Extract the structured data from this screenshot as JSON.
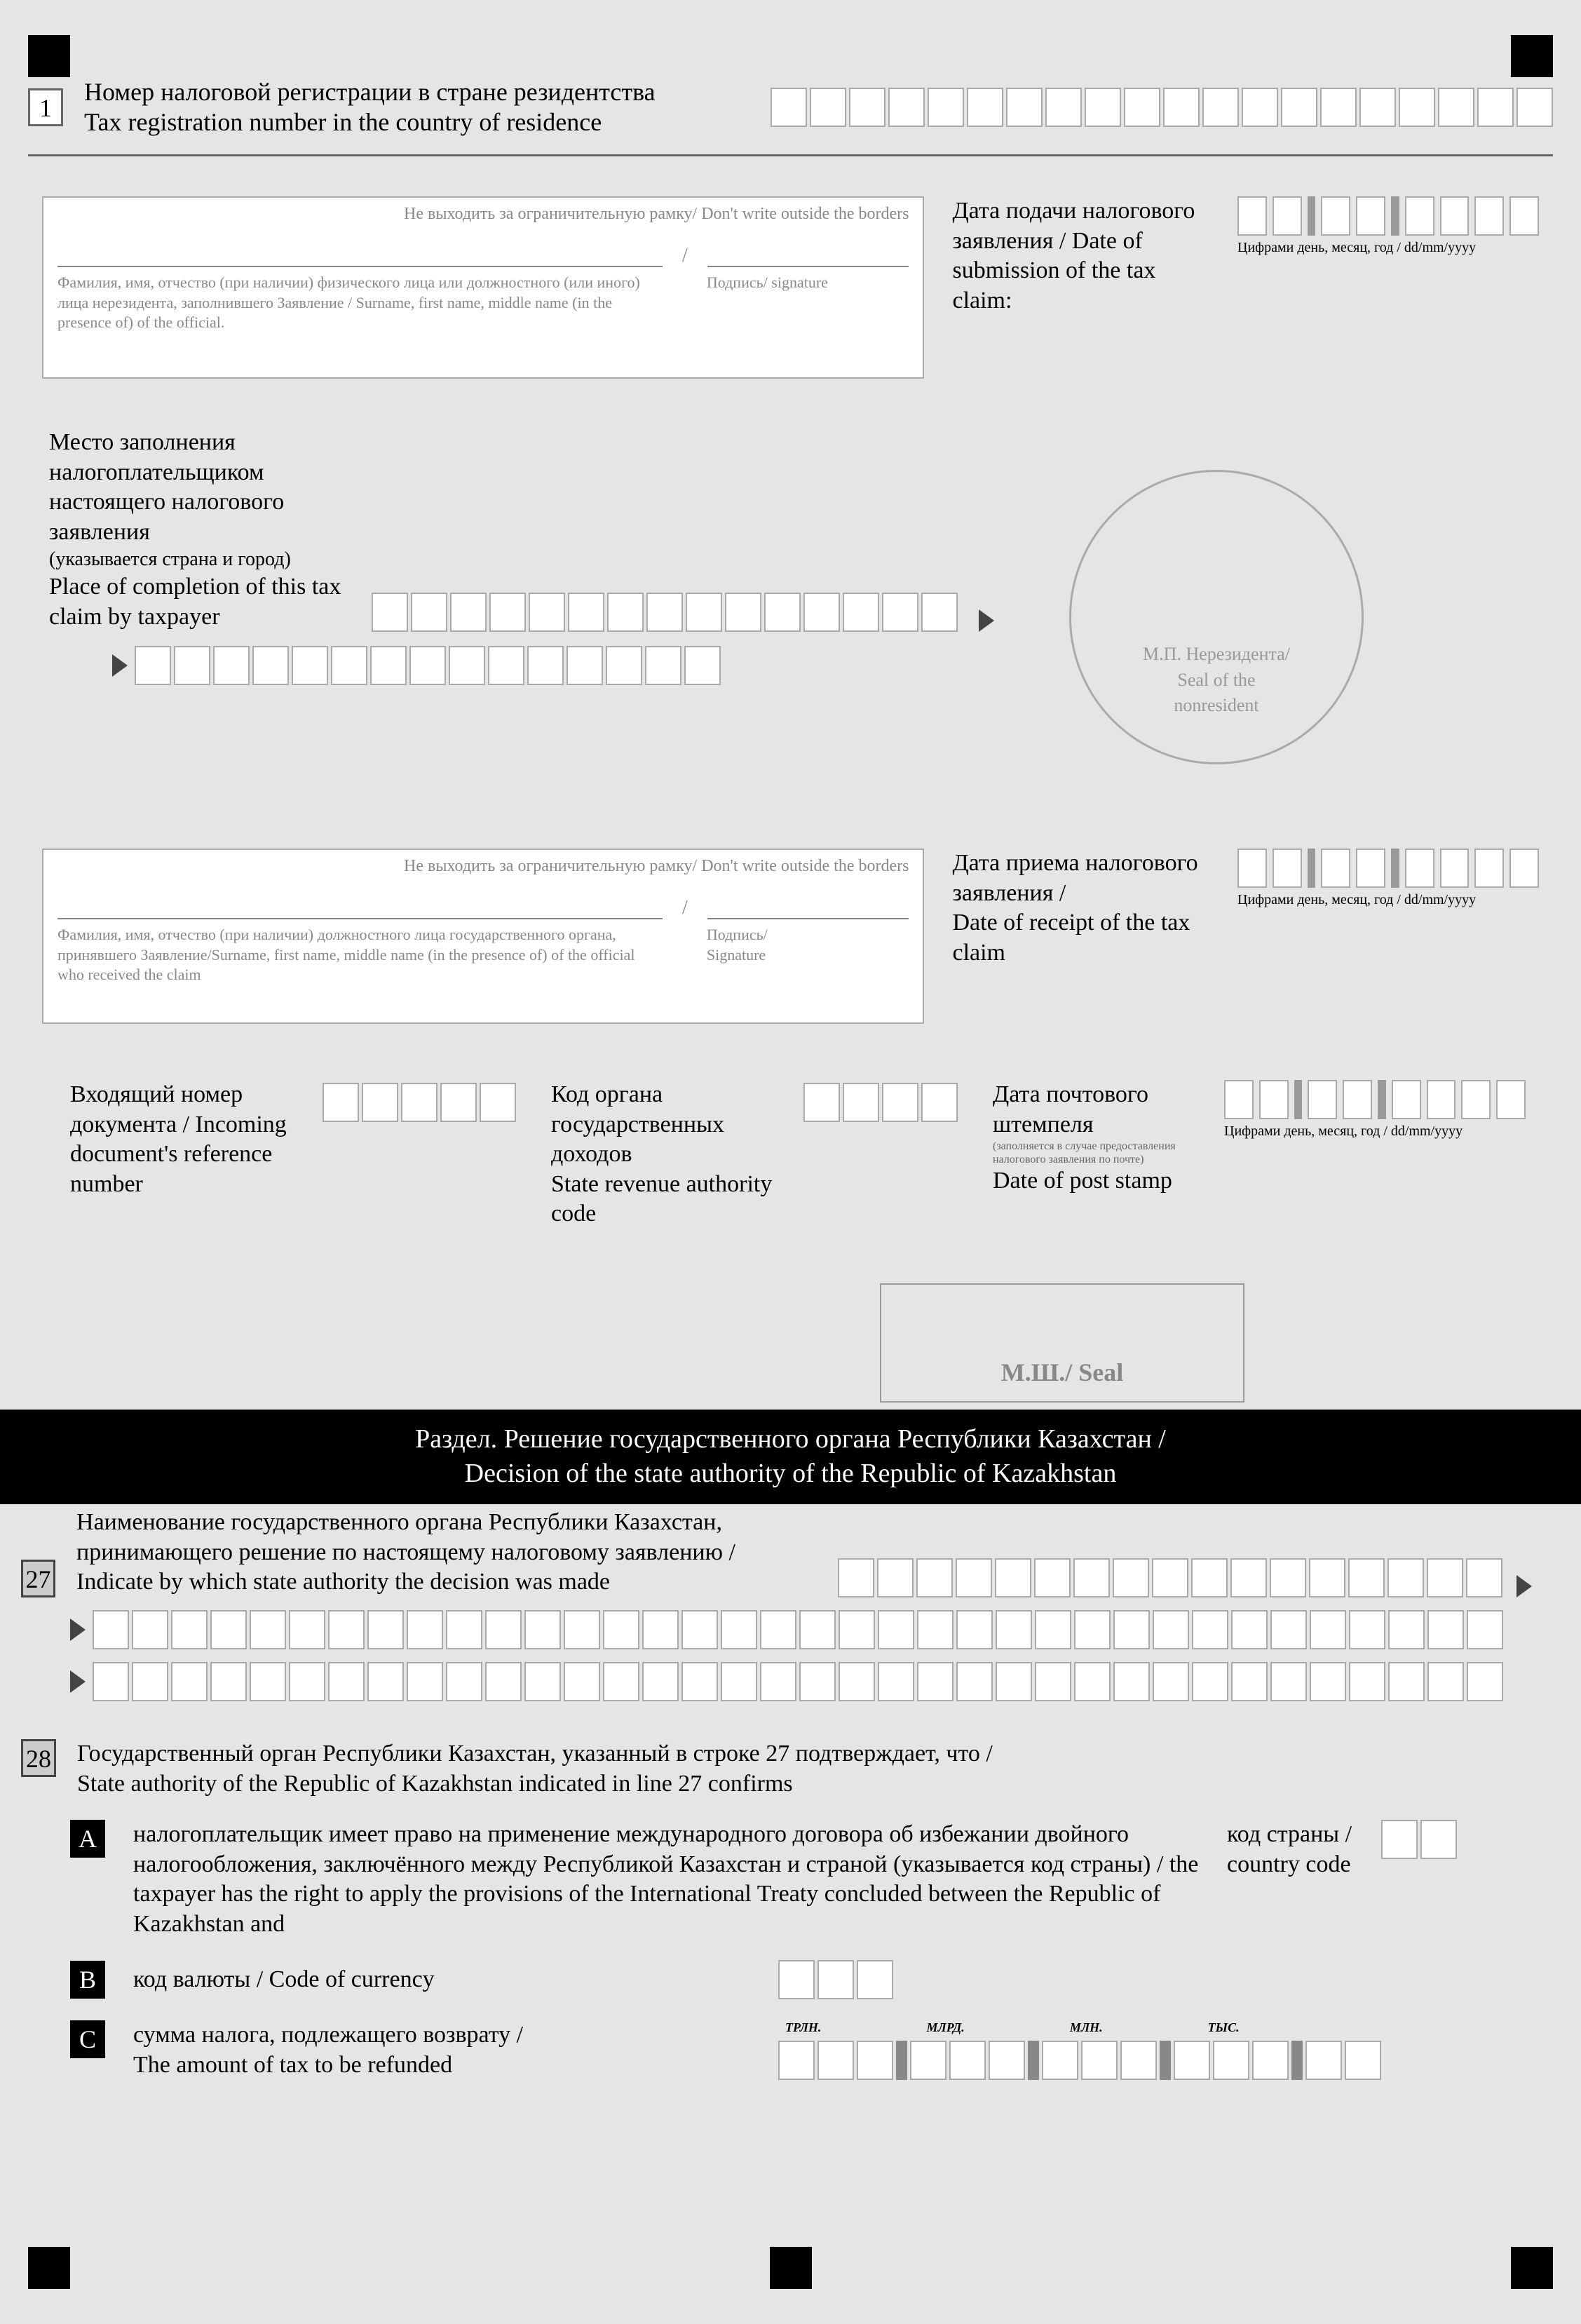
{
  "row1": {
    "num": "1",
    "label_ru": "Номер налоговой регистрации в стране резидентства",
    "label_en": "Tax registration number in the country of residence"
  },
  "sigbox1": {
    "border_warning": "Не выходить за ограничительную рамку/ Don't write outside the borders",
    "caption_left": "Фамилия, имя, отчество (при наличии) физического лица или должностного (или иного) лица нерезидента, заполнившего Заявление / Surname, first name, middle name  (in the presence of) of the official.",
    "caption_right": "Подпись/ signature"
  },
  "date_submission": {
    "label": "Дата подачи налогового заявления / Date of submission of the tax claim:",
    "caption": "Цифрами день, месяц, год / dd/mm/yyyy"
  },
  "place": {
    "label_ru": "Место заполнения налогоплательщиком настоящего налогового заявления",
    "label_note": "(указывается страна и город)",
    "label_en": "Place of completion of this tax claim by taxpayer"
  },
  "seal_circle": "М.П. Нерезидента/\nSeal of the\nnonresident",
  "sigbox2": {
    "border_warning": "Не выходить за ограничительную рамку/ Don't write outside the borders",
    "caption_left": "Фамилия, имя, отчество (при наличии) должностного лица государственного органа, принявшего Заявление/Surname, first name, middle name  (in the presence of) of the official who received the claim",
    "caption_right": "Подпись/\nSignature"
  },
  "date_receipt": {
    "label": "Дата приема налогового заявления /\nDate of receipt of the tax claim",
    "caption": "Цифрами день, месяц, год / dd/mm/yyyy"
  },
  "incoming": {
    "label": "Входящий номер документа / Incoming document's reference number"
  },
  "authority_code": {
    "label": "Код органа государственных доходов\nState revenue authority code"
  },
  "post_stamp": {
    "label": "Дата почтового штемпеля",
    "note": "(заполняется в случае предоставления налогового заявления по почте)",
    "label_en": "Date of post stamp",
    "caption": "Цифрами день, месяц, год / dd/mm/yyyy"
  },
  "seal_rect": "М.Ш./ Seal",
  "black_band": "Раздел. Решение государственного органа Республики Казахстан /\nDecision of the state authority of the Republic of Kazakhstan",
  "row27": {
    "num": "27",
    "label": "Наименование государственного органа Республики Казахстан, принимающего решение по настоящему налоговому заявлению /\nIndicate by which state authority the decision was made"
  },
  "row28": {
    "num": "28",
    "label": "Государственный орган Республики Казахстан, указанный в строке 27 подтверждает, что /\nState authority of the Republic of Kazakhstan indicated in line 27 confirms",
    "A": {
      "letter": "A",
      "text": "налогоплательщик имеет право на применение международного договора об избежании двойного налогообложения, заключённого между Республикой Казахстан и страной (указывается код страны) / the taxpayer has the right to apply the provisions of the International Treaty concluded between the Republic of Kazakhstan and",
      "country_label": "код страны /\ncountry code"
    },
    "B": {
      "letter": "B",
      "text": "код валюты / Code of currency"
    },
    "C": {
      "letter": "C",
      "text": "сумма налога, подлежащего возврату /\nThe amount of tax to be refunded",
      "units": {
        "trln": "ТРЛН.",
        "mlrd": "МЛРД.",
        "mln": "МЛН.",
        "tys": "ТЫС."
      }
    }
  }
}
